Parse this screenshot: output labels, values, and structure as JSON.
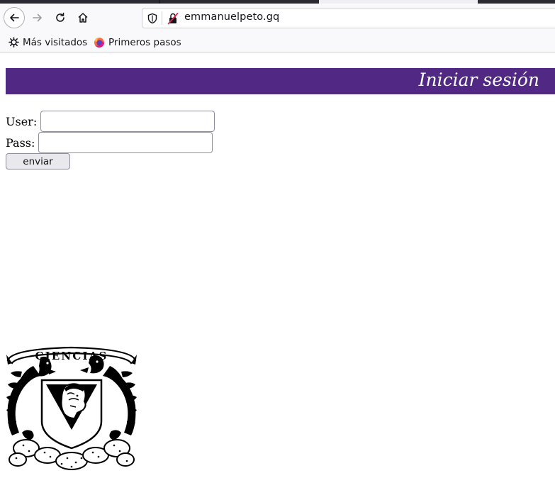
{
  "browser": {
    "url": "emmanuelpeto.gq",
    "bookmarks": [
      {
        "label": "Más visitados",
        "icon": "gear-icon"
      },
      {
        "label": "Primeros pasos",
        "icon": "firefox-icon"
      }
    ]
  },
  "page": {
    "header_title": "Iniciar sesión",
    "header_color": "#512984",
    "form": {
      "user_label": "User:",
      "user_value": "",
      "pass_label": "Pass:",
      "pass_value": "",
      "submit_label": "enviar"
    },
    "logo": {
      "text": "CIENCIAS",
      "icon": "unam-ciencias-crest-icon"
    }
  }
}
